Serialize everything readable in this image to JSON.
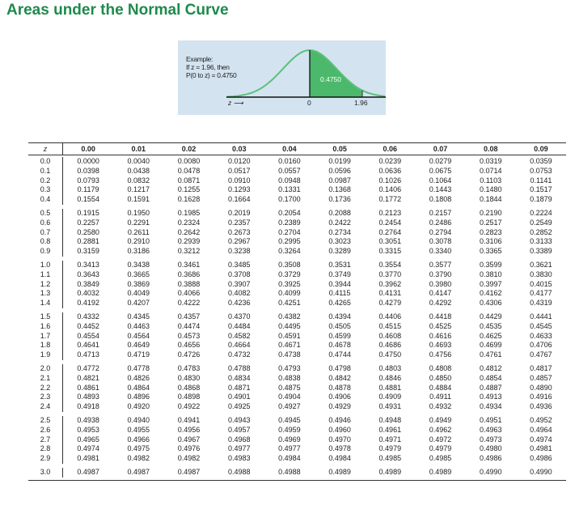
{
  "title": "Areas under the Normal Curve",
  "figure": {
    "example_line1": "Example:",
    "example_line2": "If z = 1.96, then",
    "example_line3": "P(0 to z) = 0.4750",
    "area_label": "0.4750",
    "axis_label": "z ⟶",
    "tick_zero": "0",
    "tick_z": "1.96",
    "shade_color": "#4cb86b",
    "curve_color": "#5cc07a",
    "background_color": "#d3e3f0"
  },
  "table": {
    "z_header": "z",
    "columns": [
      "0.00",
      "0.01",
      "0.02",
      "0.03",
      "0.04",
      "0.05",
      "0.06",
      "0.07",
      "0.08",
      "0.09"
    ],
    "groups": [
      [
        [
          "0.0",
          "0.0000",
          "0.0040",
          "0.0080",
          "0.0120",
          "0.0160",
          "0.0199",
          "0.0239",
          "0.0279",
          "0.0319",
          "0.0359"
        ],
        [
          "0.1",
          "0.0398",
          "0.0438",
          "0.0478",
          "0.0517",
          "0.0557",
          "0.0596",
          "0.0636",
          "0.0675",
          "0.0714",
          "0.0753"
        ],
        [
          "0.2",
          "0.0793",
          "0.0832",
          "0.0871",
          "0.0910",
          "0.0948",
          "0.0987",
          "0.1026",
          "0.1064",
          "0.1103",
          "0.1141"
        ],
        [
          "0.3",
          "0.1179",
          "0.1217",
          "0.1255",
          "0.1293",
          "0.1331",
          "0.1368",
          "0.1406",
          "0.1443",
          "0.1480",
          "0.1517"
        ],
        [
          "0.4",
          "0.1554",
          "0.1591",
          "0.1628",
          "0.1664",
          "0.1700",
          "0.1736",
          "0.1772",
          "0.1808",
          "0.1844",
          "0.1879"
        ]
      ],
      [
        [
          "0.5",
          "0.1915",
          "0.1950",
          "0.1985",
          "0.2019",
          "0.2054",
          "0.2088",
          "0.2123",
          "0.2157",
          "0.2190",
          "0.2224"
        ],
        [
          "0.6",
          "0.2257",
          "0.2291",
          "0.2324",
          "0.2357",
          "0.2389",
          "0.2422",
          "0.2454",
          "0.2486",
          "0.2517",
          "0.2549"
        ],
        [
          "0.7",
          "0.2580",
          "0.2611",
          "0.2642",
          "0.2673",
          "0.2704",
          "0.2734",
          "0.2764",
          "0.2794",
          "0.2823",
          "0.2852"
        ],
        [
          "0.8",
          "0.2881",
          "0.2910",
          "0.2939",
          "0.2967",
          "0.2995",
          "0.3023",
          "0.3051",
          "0.3078",
          "0.3106",
          "0.3133"
        ],
        [
          "0.9",
          "0.3159",
          "0.3186",
          "0.3212",
          "0.3238",
          "0.3264",
          "0.3289",
          "0.3315",
          "0.3340",
          "0.3365",
          "0.3389"
        ]
      ],
      [
        [
          "1.0",
          "0.3413",
          "0.3438",
          "0.3461",
          "0.3485",
          "0.3508",
          "0.3531",
          "0.3554",
          "0.3577",
          "0.3599",
          "0.3621"
        ],
        [
          "1.1",
          "0.3643",
          "0.3665",
          "0.3686",
          "0.3708",
          "0.3729",
          "0.3749",
          "0.3770",
          "0.3790",
          "0.3810",
          "0.3830"
        ],
        [
          "1.2",
          "0.3849",
          "0.3869",
          "0.3888",
          "0.3907",
          "0.3925",
          "0.3944",
          "0.3962",
          "0.3980",
          "0.3997",
          "0.4015"
        ],
        [
          "1.3",
          "0.4032",
          "0.4049",
          "0.4066",
          "0.4082",
          "0.4099",
          "0.4115",
          "0.4131",
          "0.4147",
          "0.4162",
          "0.4177"
        ],
        [
          "1.4",
          "0.4192",
          "0.4207",
          "0.4222",
          "0.4236",
          "0.4251",
          "0.4265",
          "0.4279",
          "0.4292",
          "0.4306",
          "0.4319"
        ]
      ],
      [
        [
          "1.5",
          "0.4332",
          "0.4345",
          "0.4357",
          "0.4370",
          "0.4382",
          "0.4394",
          "0.4406",
          "0.4418",
          "0.4429",
          "0.4441"
        ],
        [
          "1.6",
          "0.4452",
          "0.4463",
          "0.4474",
          "0.4484",
          "0.4495",
          "0.4505",
          "0.4515",
          "0.4525",
          "0.4535",
          "0.4545"
        ],
        [
          "1.7",
          "0.4554",
          "0.4564",
          "0.4573",
          "0.4582",
          "0.4591",
          "0.4599",
          "0.4608",
          "0.4616",
          "0.4625",
          "0.4633"
        ],
        [
          "1.8",
          "0.4641",
          "0.4649",
          "0.4656",
          "0.4664",
          "0.4671",
          "0.4678",
          "0.4686",
          "0.4693",
          "0.4699",
          "0.4706"
        ],
        [
          "1.9",
          "0.4713",
          "0.4719",
          "0.4726",
          "0.4732",
          "0.4738",
          "0.4744",
          "0.4750",
          "0.4756",
          "0.4761",
          "0.4767"
        ]
      ],
      [
        [
          "2.0",
          "0.4772",
          "0.4778",
          "0.4783",
          "0.4788",
          "0.4793",
          "0.4798",
          "0.4803",
          "0.4808",
          "0.4812",
          "0.4817"
        ],
        [
          "2.1",
          "0.4821",
          "0.4826",
          "0.4830",
          "0.4834",
          "0.4838",
          "0.4842",
          "0.4846",
          "0.4850",
          "0.4854",
          "0.4857"
        ],
        [
          "2.2",
          "0.4861",
          "0.4864",
          "0.4868",
          "0.4871",
          "0.4875",
          "0.4878",
          "0.4881",
          "0.4884",
          "0.4887",
          "0.4890"
        ],
        [
          "2.3",
          "0.4893",
          "0.4896",
          "0.4898",
          "0.4901",
          "0.4904",
          "0.4906",
          "0.4909",
          "0.4911",
          "0.4913",
          "0.4916"
        ],
        [
          "2.4",
          "0.4918",
          "0.4920",
          "0.4922",
          "0.4925",
          "0.4927",
          "0.4929",
          "0.4931",
          "0.4932",
          "0.4934",
          "0.4936"
        ]
      ],
      [
        [
          "2.5",
          "0.4938",
          "0.4940",
          "0.4941",
          "0.4943",
          "0.4945",
          "0.4946",
          "0.4948",
          "0.4949",
          "0.4951",
          "0.4952"
        ],
        [
          "2.6",
          "0.4953",
          "0.4955",
          "0.4956",
          "0.4957",
          "0.4959",
          "0.4960",
          "0.4961",
          "0.4962",
          "0.4963",
          "0.4964"
        ],
        [
          "2.7",
          "0.4965",
          "0.4966",
          "0.4967",
          "0.4968",
          "0.4969",
          "0.4970",
          "0.4971",
          "0.4972",
          "0.4973",
          "0.4974"
        ],
        [
          "2.8",
          "0.4974",
          "0.4975",
          "0.4976",
          "0.4977",
          "0.4977",
          "0.4978",
          "0.4979",
          "0.4979",
          "0.4980",
          "0.4981"
        ],
        [
          "2.9",
          "0.4981",
          "0.4982",
          "0.4982",
          "0.4983",
          "0.4984",
          "0.4984",
          "0.4985",
          "0.4985",
          "0.4986",
          "0.4986"
        ]
      ],
      [
        [
          "3.0",
          "0.4987",
          "0.4987",
          "0.4987",
          "0.4988",
          "0.4988",
          "0.4989",
          "0.4989",
          "0.4989",
          "0.4990",
          "0.4990"
        ]
      ]
    ]
  }
}
